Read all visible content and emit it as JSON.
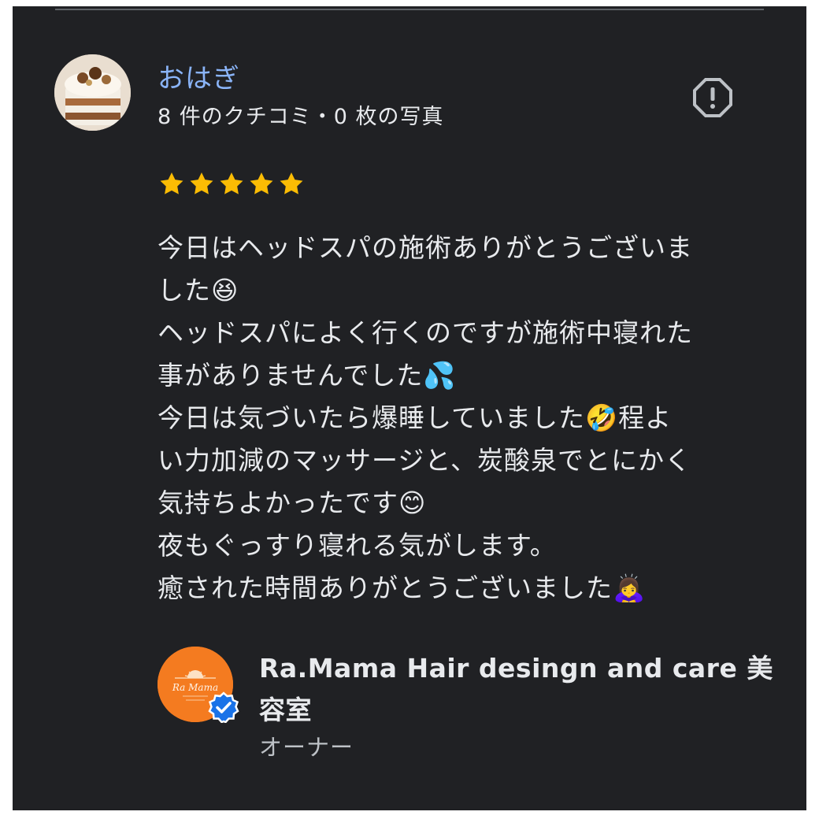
{
  "review": {
    "reviewer_name": "おはぎ",
    "reviewer_meta": "8 件のクチコミ・0 枚の写真",
    "rating": 5,
    "star_color": "#fbbc04",
    "report_icon": "report-icon",
    "lines": [
      "今日はヘッドスパの施術ありがとうございま",
      "した😆",
      "ヘッドスパによく行くのですが施術中寝れた",
      "事がありませんでした💦",
      "今日は気づいたら爆睡していました🤣程よ",
      "い力加減のマッサージと、炭酸泉でとにかく",
      "気持ちよかったです😊",
      "夜もぐっすり寝れる気がします。",
      "癒された時間ありがとうございました🙇‍♀️"
    ]
  },
  "owner": {
    "logo_text": "Ra Mama",
    "name_line1": "Ra.Mama Hair desingn and care 美",
    "name_line2": "容室",
    "role": "オーナー",
    "badge_icon": "verified-badge-icon",
    "brand_color": "#f47b20"
  },
  "colors": {
    "background": "#202124",
    "name_link": "#8ab4f8",
    "text": "#e8eaed",
    "secondary_text": "#bdc1c6"
  }
}
